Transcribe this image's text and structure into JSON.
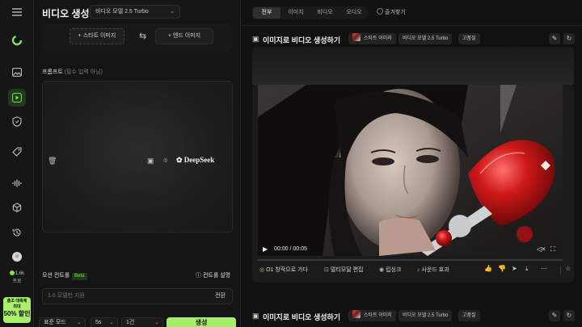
{
  "sidebar": {
    "menu_icon": "menu-icon",
    "logo_icon": "logo-icon",
    "items": [
      {
        "icon": "image-icon"
      },
      {
        "icon": "video-icon"
      },
      {
        "icon": "shield-icon"
      },
      {
        "icon": "tag-icon"
      },
      {
        "icon": "audio-icon"
      },
      {
        "icon": "cube-icon"
      },
      {
        "icon": "history-icon"
      },
      {
        "icon": "avatar"
      }
    ],
    "credits": "1.6k",
    "plan": "프로",
    "promo": {
      "line1": "출조 대축제",
      "line2": "최대",
      "line3": "50% 할인"
    }
  },
  "panel": {
    "title": "비디오 생성",
    "model": "비디오 모델 2.5 Turbo",
    "start_frame": "스타트 이미지",
    "end_frame": "엔드 이미지",
    "prompt_label": "프롬프트",
    "prompt_sub": "(필수 입력 아님)",
    "deepseek": "DeepSeek",
    "motion_label": "모션 컨트롤",
    "beta": "Beta",
    "control_settings": "컨트롤 설명",
    "hint_placeholder": "1.6 모델만 지원",
    "convert": "전환",
    "options": [
      "표준 모드",
      "5s",
      "1건"
    ],
    "generate": "생성"
  },
  "main": {
    "tabs": [
      "전부",
      "이미지",
      "비디오",
      "오디오"
    ],
    "favorites": "즐겨찾기",
    "card": {
      "title": "이미지로 비디오 생성하기",
      "chip_start": "스타트 이미지",
      "chip_model": "비디오 모델 2.5 Turbo",
      "chip_mode": "고품질"
    },
    "player": {
      "time": "00:00 / 00:05",
      "progress": 0
    },
    "actions": {
      "model_tag": "O1 창작으로 가다",
      "multimodal": "멀티모달 편집",
      "lipsync": "립싱크",
      "sound": "사운드 효과"
    }
  }
}
